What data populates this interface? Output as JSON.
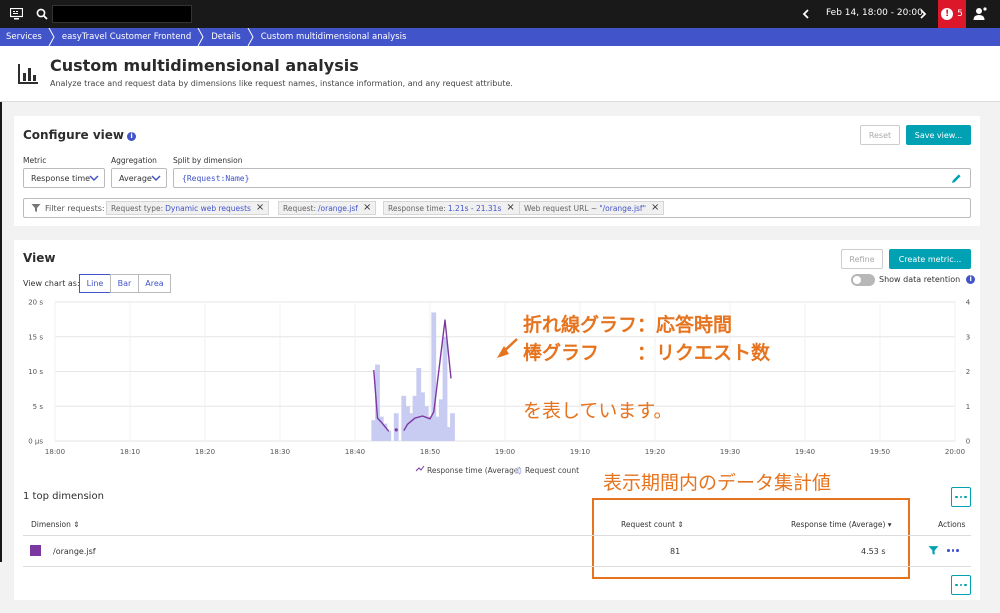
{
  "topbar": {
    "timeframe": "Feb 14, 18:00 - 20:00",
    "problems_count": "5",
    "problem_mark": "!"
  },
  "breadcrumb": [
    "Services",
    "easyTravel Customer Frontend",
    "Details",
    "Custom multidimensional analysis"
  ],
  "header": {
    "title": "Custom multidimensional analysis",
    "subtitle": "Analyze trace and request data by dimensions like request names, instance information, and any request attribute."
  },
  "configure": {
    "title": "Configure view",
    "info_mark": "i",
    "reset_label": "Reset",
    "save_label": "Save view...",
    "metric_label": "Metric",
    "metric_value": "Response time",
    "aggregation_label": "Aggregation",
    "aggregation_value": "Average",
    "split_label": "Split by dimension",
    "split_value": "{Request:Name}",
    "filter_label": "Filter requests:",
    "filters": [
      {
        "key": "Request type:",
        "value": "Dynamic web requests"
      },
      {
        "key": "Request:",
        "value": "/orange.jsf"
      },
      {
        "key": "Response time:",
        "value": "1.21s - 21.31s"
      },
      {
        "key": "Web request URL ~",
        "value": "\"/orange.jsf\""
      }
    ],
    "chip_close": "×"
  },
  "view": {
    "title": "View",
    "refine_label": "Refine",
    "create_metric_label": "Create metric...",
    "chart_as_label": "View chart as:",
    "chart_types": [
      "Line",
      "Bar",
      "Area"
    ],
    "active_chart_type": "Line",
    "show_retention_label": "Show data retention",
    "info_mark": "i"
  },
  "chart_data": {
    "type": "line",
    "x_ticks": [
      "18:00",
      "18:10",
      "18:20",
      "18:30",
      "18:40",
      "18:50",
      "19:00",
      "19:10",
      "19:20",
      "19:30",
      "19:40",
      "19:50",
      "20:00"
    ],
    "y_left_ticks": [
      "0 μs",
      "5 s",
      "10 s",
      "15 s",
      "20 s"
    ],
    "y_left_range": [
      0,
      20
    ],
    "y_right_ticks": [
      "0",
      "1",
      "2",
      "3",
      "4"
    ],
    "y_right_range": [
      0,
      4
    ],
    "grid": true,
    "legend_position": "bottom",
    "series": [
      {
        "name": "Response time (Average)",
        "kind": "line",
        "color": "#7c38a1",
        "segments": [
          [
            [
              42.5,
              10.2
            ],
            [
              43.0,
              3.3
            ],
            [
              43.5,
              2.7
            ],
            [
              44.5,
              1.4
            ]
          ],
          [
            [
              45.5,
              1.6
            ]
          ],
          [
            [
              46.5,
              1.5
            ],
            [
              47.0,
              2.4
            ],
            [
              48.0,
              3.3
            ],
            [
              49.0,
              3.6
            ],
            [
              50.0,
              3.2
            ],
            [
              50.5,
              4.2
            ],
            [
              52.0,
              17.4
            ],
            [
              52.8,
              9.0
            ]
          ]
        ]
      },
      {
        "name": "Request count",
        "kind": "bar",
        "color": "#c9ccf2",
        "x": [
          42.5,
          43.0,
          43.5,
          44.0,
          44.5,
          45.5,
          46.5,
          47.0,
          47.5,
          48.0,
          48.5,
          49.0,
          49.5,
          50.0,
          50.5,
          51.0,
          51.5,
          52.0,
          52.5,
          53.0
        ],
        "values": [
          0.6,
          2.2,
          0.7,
          0.5,
          0.3,
          0.8,
          1.3,
          1.0,
          0.8,
          1.3,
          2.1,
          1.4,
          1.0,
          0.7,
          3.7,
          0.7,
          1.2,
          3.0,
          0.4,
          0.8
        ]
      }
    ]
  },
  "annotation": {
    "line1": "折れ線グラフ：応答時間",
    "line2": "棒グラフ　　：リクエスト数",
    "line3": "を表しています。",
    "box_label": "表示期間内のデータ集計値"
  },
  "table": {
    "title": "1 top dimension",
    "columns": {
      "dimension": "Dimension",
      "request_count": "Request count",
      "response_time": "Response time (Average)",
      "actions": "Actions"
    },
    "rows": [
      {
        "dimension": "/orange.jsf",
        "request_count": "81",
        "response_time": "4.53 s",
        "color": "#7c38a1"
      }
    ]
  },
  "colors": {
    "accent": "#4254c9",
    "teal": "#00a1b2",
    "problem_red": "#dc172a",
    "annotation_orange": "#e6731e"
  },
  "icons": [
    "menu-icon",
    "search-icon",
    "chevron-left-icon",
    "chevron-right-icon",
    "user-icon",
    "chart-bars-icon",
    "pencil-icon",
    "filter-icon",
    "sort-icon",
    "chevron-down-icon"
  ]
}
